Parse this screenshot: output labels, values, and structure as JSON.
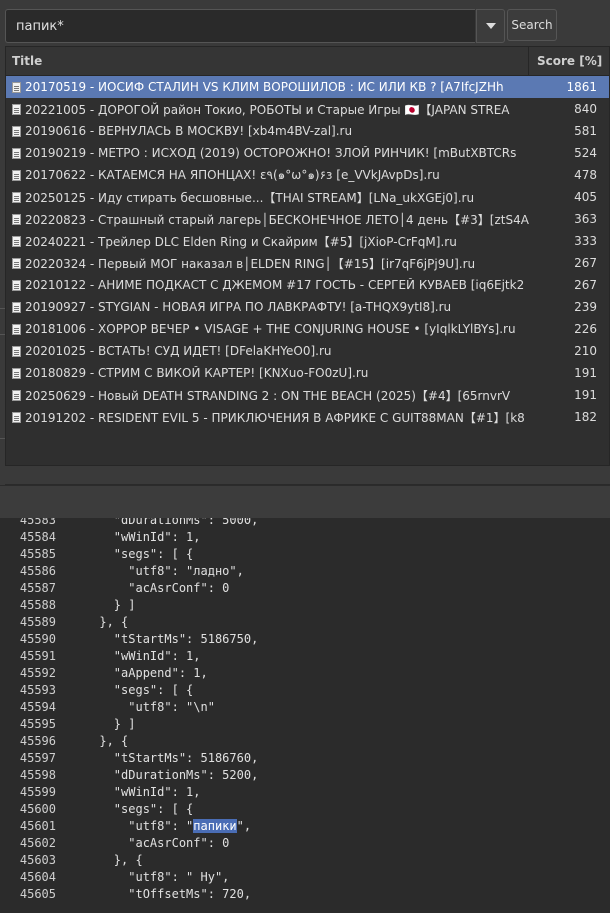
{
  "search": {
    "value": "папик*",
    "button_label": "Search"
  },
  "results": {
    "columns": {
      "title": "Title",
      "score": "Score [%]"
    },
    "rows": [
      {
        "title": "20170519 - ИОСИФ СТАЛИН VS КЛИМ ВОРОШИЛОВ :  ИС ИЛИ КВ ? [A7IfcJZHh",
        "score": "1861",
        "selected": true
      },
      {
        "title": "20221005 - ДОРОГОЙ район Токио, РОБОТЫ и Старые Игры 🇯🇵【JAPAN STREA",
        "score": "840"
      },
      {
        "title": "20190616 - ВЕРНУЛАСЬ В МОСКВУ! [xb4m4BV-zal].ru",
        "score": "581"
      },
      {
        "title": "20190219 - МЕТРО :  ИСХОД (2019) ОСТОРОЖНО! ЗЛОЙ РИНЧИК! [mButXBTCRs",
        "score": "524"
      },
      {
        "title": "20170622 - КАТАЕМСЯ НА ЯПОНЦАХ! ε٩(๑°ω°๑)۶з [e_VVkJAvpDs].ru",
        "score": "478"
      },
      {
        "title": "20250125 - Иду стирать бесшовные...【THAI STREAM】[LNa_ukXGEj0].ru",
        "score": "405"
      },
      {
        "title": "20220823 - Страшный старый лагерь│БЕСКОНЕЧНОЕ ЛЕТО│4 день【#3】[ztS4A",
        "score": "363"
      },
      {
        "title": "20240221 - Трейлер DLC Elden Ring и Скайрим【#5】[jXioP-CrFqM].ru",
        "score": "333"
      },
      {
        "title": "20220324 - Первый МОГ наказал в│ELDEN RING│【#15】[ir7qF6jPj9U].ru",
        "score": "267"
      },
      {
        "title": "20210122 - АНИМЕ ПОДКАСТ С ДЖЕМОМ #17 ГОСТЬ -  СЕРГЕЙ КУВАЕВ [iq6Ejtk2",
        "score": "267"
      },
      {
        "title": "20190927 - STYGIAN - НОВАЯ ИГРА ПО ЛАВКРАФТУ! [a-THQX9ytI8].ru",
        "score": "239"
      },
      {
        "title": "20181006 - ХОРРОР ВЕЧЕР • VISAGE + THE CONJURING HOUSE • [yIqlkLYlBYs].ru",
        "score": "226"
      },
      {
        "title": "20201025 - ВСТАТЬ! СУД ИДЕТ! [DFelaKHYeO0].ru",
        "score": "210"
      },
      {
        "title": "20180829 - СТРИМ С ВИКОЙ КАРТЕР! [KNXuo-FO0zU].ru",
        "score": "191"
      },
      {
        "title": "20250629 - Новый DEATH STRANDING 2 :  ON THE BEACH (2025)【#4】[65rnvrV",
        "score": "191"
      },
      {
        "title": "20191202 - RESIDENT EVIL 5 - ПРИКЛЮЧЕНИЯ В АФРИКЕ С GUIT88MAN【#1】[k8",
        "score": "182"
      }
    ]
  },
  "code": {
    "lines": [
      {
        "n": "45583",
        "text": "      \"dDurationMs\": 5000,"
      },
      {
        "n": "45584",
        "text": "      \"wWinId\": 1,"
      },
      {
        "n": "45585",
        "text": "      \"segs\": [ {"
      },
      {
        "n": "45586",
        "text": "        \"utf8\": \"ладно\","
      },
      {
        "n": "45587",
        "text": "        \"acAsrConf\": 0"
      },
      {
        "n": "45588",
        "text": "      } ]"
      },
      {
        "n": "45589",
        "text": "    }, {"
      },
      {
        "n": "45590",
        "text": "      \"tStartMs\": 5186750,"
      },
      {
        "n": "45591",
        "text": "      \"wWinId\": 1,"
      },
      {
        "n": "45592",
        "text": "      \"aAppend\": 1,"
      },
      {
        "n": "45593",
        "text": "      \"segs\": [ {"
      },
      {
        "n": "45594",
        "text": "        \"utf8\": \"\\n\""
      },
      {
        "n": "45595",
        "text": "      } ]"
      },
      {
        "n": "45596",
        "text": "    }, {"
      },
      {
        "n": "45597",
        "text": "      \"tStartMs\": 5186760,"
      },
      {
        "n": "45598",
        "text": "      \"dDurationMs\": 5200,"
      },
      {
        "n": "45599",
        "text": "      \"wWinId\": 1,"
      },
      {
        "n": "45600",
        "text": "      \"segs\": [ {"
      },
      {
        "n": "45601",
        "pre": "        \"utf8\": \"",
        "hl": "папики",
        "post": "\","
      },
      {
        "n": "45602",
        "text": "        \"acAsrConf\": 0"
      },
      {
        "n": "45603",
        "text": "      }, {"
      },
      {
        "n": "45604",
        "text": "        \"utf8\": \" Ну\","
      },
      {
        "n": "45605",
        "text": "        \"tOffsetMs\": 720,"
      }
    ]
  },
  "colors": {
    "selection": "#5b79b3",
    "highlight": "#4a6db5",
    "background": "#2b2b2b"
  },
  "icons": {
    "dropdown": "chevron-down-icon",
    "row": "document-icon"
  }
}
